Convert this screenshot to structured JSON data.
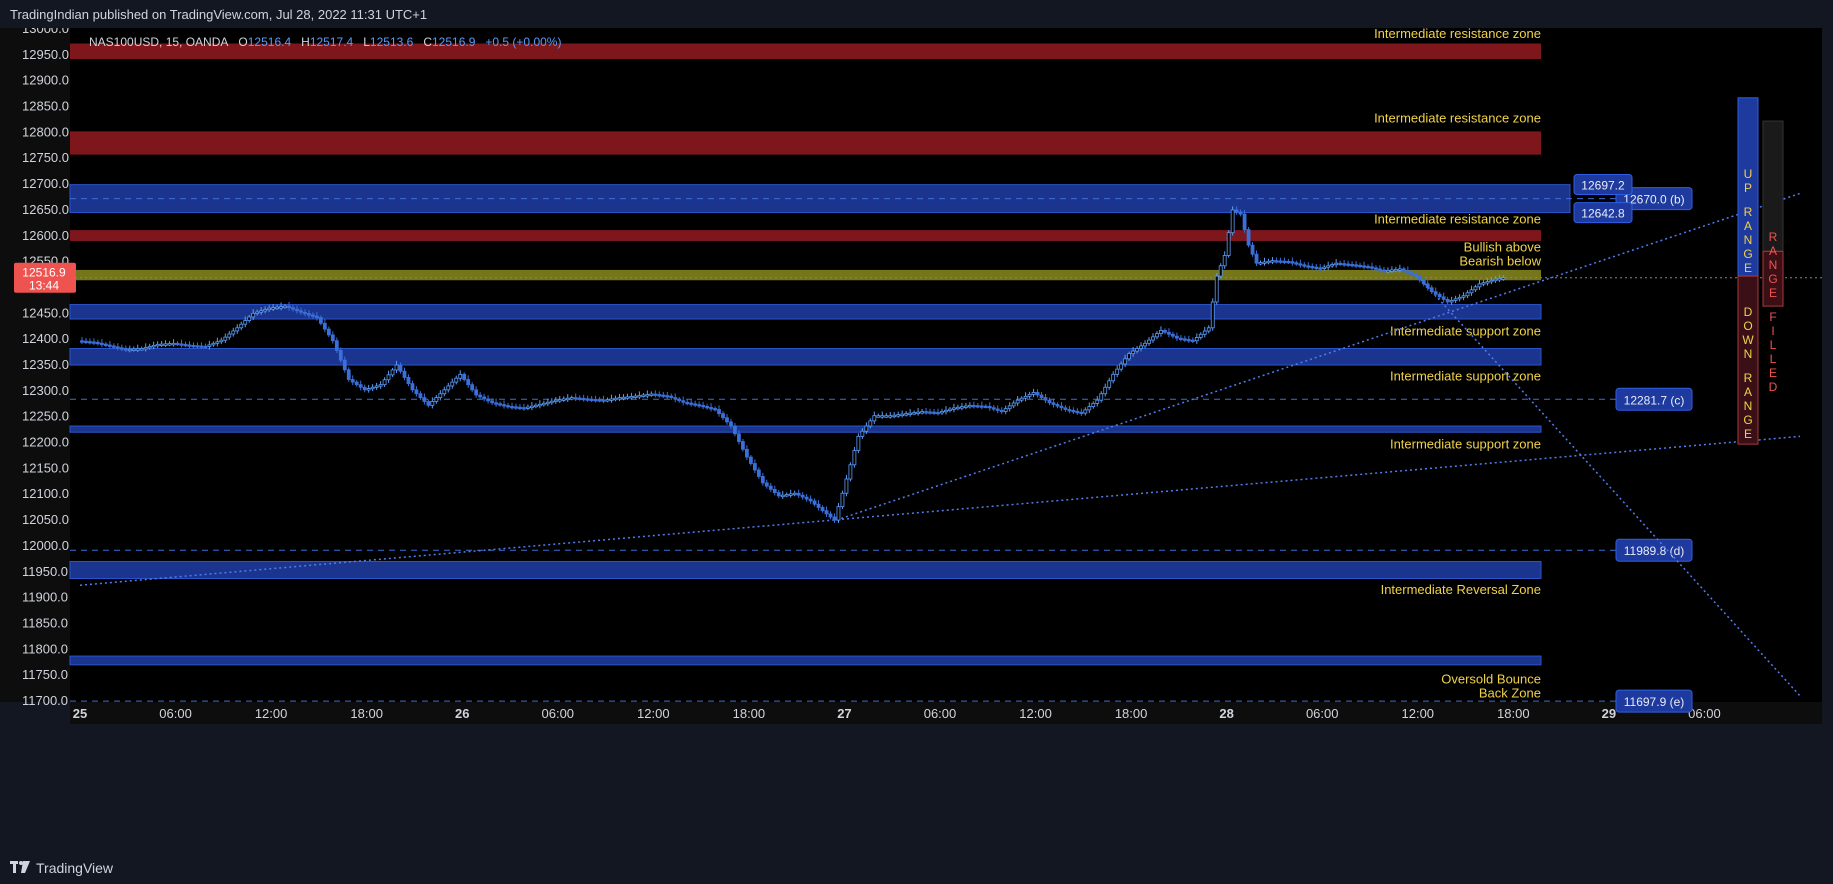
{
  "header": {
    "publish_text": "TradingIndian published on TradingView.com, Jul 28, 2022 11:31 UTC+1"
  },
  "footer": {
    "brand": "TradingView",
    "logo_icon": "tradingview-logo-icon"
  },
  "legend": {
    "symbol": "NAS100USD, 15, OANDA",
    "o_label": "O",
    "o": "12516.4",
    "h_label": "H",
    "h": "12517.4",
    "l_label": "L",
    "l": "12513.6",
    "c_label": "C",
    "c": "12516.9",
    "change": "+0.5 (+0.00%)"
  },
  "chart_data": {
    "type": "candlestick",
    "title": "",
    "ylim": [
      11700,
      13000
    ],
    "y_ticks": [
      13000,
      12950,
      12900,
      12850,
      12800,
      12750,
      12700,
      12650,
      12600,
      12550,
      12500,
      12450,
      12400,
      12350,
      12300,
      12250,
      12200,
      12150,
      12100,
      12050,
      12000,
      11950,
      11900,
      11850,
      11800,
      11750,
      11700
    ],
    "x_range_hours": [
      0,
      108
    ],
    "x_ticks": [
      {
        "label": "25",
        "h": 0,
        "bold": true
      },
      {
        "label": "06:00",
        "h": 6
      },
      {
        "label": "12:00",
        "h": 12
      },
      {
        "label": "18:00",
        "h": 18
      },
      {
        "label": "26",
        "h": 24,
        "bold": true
      },
      {
        "label": "06:00",
        "h": 30
      },
      {
        "label": "12:00",
        "h": 36
      },
      {
        "label": "18:00",
        "h": 42
      },
      {
        "label": "27",
        "h": 48,
        "bold": true
      },
      {
        "label": "06:00",
        "h": 54
      },
      {
        "label": "12:00",
        "h": 60
      },
      {
        "label": "18:00",
        "h": 66
      },
      {
        "label": "28",
        "h": 72,
        "bold": true
      },
      {
        "label": "06:00",
        "h": 78
      },
      {
        "label": "12:00",
        "h": 84
      },
      {
        "label": "18:00",
        "h": 90
      },
      {
        "label": "29",
        "h": 96,
        "bold": true
      },
      {
        "label": "06:00",
        "h": 102
      }
    ],
    "current_price": {
      "value": 12516.9,
      "label": "12516.9",
      "countdown": "13:44"
    },
    "colors": {
      "up": "#5b9cf6",
      "down": "#3b6fd9",
      "resistance": "#8b1a1f",
      "support": "#1e3a9e",
      "pivot": "#8a8a1e",
      "text_zone": "#f0d24a",
      "price_tag": "#ef5350"
    },
    "zones": [
      {
        "kind": "resistance",
        "from": 12940,
        "to": 12970,
        "label": "Intermediate resistance zone",
        "label_price": 12988
      },
      {
        "kind": "resistance",
        "from": 12755,
        "to": 12800,
        "label": "Intermediate resistance zone",
        "label_price": 12825
      },
      {
        "kind": "support",
        "from": 12643,
        "to": 12697,
        "label": ""
      },
      {
        "kind": "resistance",
        "from": 12588,
        "to": 12609,
        "label": "Intermediate resistance zone",
        "label_price": 12630
      },
      {
        "kind": "pivot",
        "from": 12512,
        "to": 12532,
        "label": "Bullish above",
        "label2": "Bearish below",
        "label_price": 12575
      },
      {
        "kind": "support",
        "from": 12437,
        "to": 12465,
        "label": "Intermediate support zone",
        "label_price": 12413
      },
      {
        "kind": "support",
        "from": 12348,
        "to": 12380,
        "label": "Intermediate support zone",
        "label_price": 12326
      },
      {
        "kind": "support",
        "from": 12218,
        "to": 12230,
        "label": "Intermediate support zone",
        "label_price": 12194
      },
      {
        "kind": "support",
        "from": 11935,
        "to": 11968,
        "label": "Intermediate Reversal Zone",
        "label_price": 11913
      },
      {
        "kind": "support",
        "from": 11768,
        "to": 11785,
        "label": "Oversold Bounce",
        "label2": "Back Zone",
        "label_price": 11740
      }
    ],
    "levels": [
      {
        "value": 12670.0,
        "label": "12670.0 (b)"
      },
      {
        "value": 12281.7,
        "label": "12281.7 (c)"
      },
      {
        "value": 11989.8,
        "label": "11989.8 (d)"
      },
      {
        "value": 11697.9,
        "label": "11697.9 (e)"
      }
    ],
    "zone_tags": [
      {
        "value": 12697.2,
        "label": "12697.2"
      },
      {
        "value": 12642.8,
        "label": "12642.8"
      }
    ],
    "trendlines": [
      {
        "h1": 0,
        "p1": 11922,
        "h2": 108,
        "p2": 12210
      },
      {
        "h1": 47.5,
        "p1": 12048,
        "h2": 108,
        "p2": 12680
      },
      {
        "h1": 84,
        "p1": 12520,
        "h2": 108,
        "p2": 11708
      }
    ],
    "range_boxes": {
      "up": {
        "label": "UP RANGE",
        "from": 12520,
        "to": 12865
      },
      "down": {
        "label": "DOWN RANGE",
        "from": 12195,
        "to": 12520
      },
      "filled": {
        "label": "RANGE FILLED",
        "from": 12462,
        "to": 12568,
        "gray_from": 12568,
        "gray_to": 12820
      }
    },
    "price_path": [
      [
        0,
        12395
      ],
      [
        1,
        12392
      ],
      [
        2,
        12385
      ],
      [
        3,
        12378
      ],
      [
        4,
        12380
      ],
      [
        5,
        12388
      ],
      [
        6,
        12390
      ],
      [
        7,
        12386
      ],
      [
        8,
        12384
      ],
      [
        9,
        12396
      ],
      [
        10,
        12420
      ],
      [
        11,
        12448
      ],
      [
        12,
        12458
      ],
      [
        13,
        12462
      ],
      [
        14,
        12450
      ],
      [
        15,
        12440
      ],
      [
        16,
        12395
      ],
      [
        17,
        12320
      ],
      [
        18,
        12300
      ],
      [
        19,
        12310
      ],
      [
        20,
        12348
      ],
      [
        21,
        12300
      ],
      [
        22,
        12270
      ],
      [
        23,
        12300
      ],
      [
        24,
        12330
      ],
      [
        25,
        12290
      ],
      [
        26,
        12275
      ],
      [
        27,
        12268
      ],
      [
        28,
        12265
      ],
      [
        29,
        12272
      ],
      [
        30,
        12280
      ],
      [
        31,
        12285
      ],
      [
        32,
        12282
      ],
      [
        33,
        12280
      ],
      [
        34,
        12285
      ],
      [
        35,
        12288
      ],
      [
        36,
        12292
      ],
      [
        37,
        12288
      ],
      [
        38,
        12276
      ],
      [
        39,
        12270
      ],
      [
        40,
        12262
      ],
      [
        41,
        12230
      ],
      [
        42,
        12170
      ],
      [
        43,
        12120
      ],
      [
        44,
        12095
      ],
      [
        45,
        12100
      ],
      [
        46,
        12085
      ],
      [
        47,
        12060
      ],
      [
        47.5,
        12048
      ],
      [
        48,
        12100
      ],
      [
        49,
        12210
      ],
      [
        50,
        12250
      ],
      [
        51,
        12250
      ],
      [
        52,
        12254
      ],
      [
        53,
        12258
      ],
      [
        54,
        12256
      ],
      [
        55,
        12265
      ],
      [
        56,
        12270
      ],
      [
        57,
        12268
      ],
      [
        58,
        12258
      ],
      [
        59,
        12280
      ],
      [
        60,
        12295
      ],
      [
        61,
        12275
      ],
      [
        62,
        12262
      ],
      [
        63,
        12255
      ],
      [
        64,
        12280
      ],
      [
        65,
        12330
      ],
      [
        66,
        12370
      ],
      [
        67,
        12390
      ],
      [
        68,
        12415
      ],
      [
        69,
        12400
      ],
      [
        70,
        12395
      ],
      [
        71,
        12420
      ],
      [
        71.5,
        12520
      ],
      [
        72,
        12560
      ],
      [
        72.5,
        12648
      ],
      [
        73,
        12640
      ],
      [
        73.5,
        12580
      ],
      [
        74,
        12545
      ],
      [
        75,
        12550
      ],
      [
        76,
        12548
      ],
      [
        77,
        12540
      ],
      [
        78,
        12535
      ],
      [
        79,
        12545
      ],
      [
        80,
        12542
      ],
      [
        81,
        12538
      ],
      [
        82,
        12530
      ],
      [
        83,
        12534
      ],
      [
        84,
        12520
      ],
      [
        85,
        12490
      ],
      [
        86,
        12470
      ],
      [
        87,
        12482
      ],
      [
        88,
        12505
      ],
      [
        89,
        12514
      ],
      [
        89.5,
        12517
      ]
    ]
  }
}
